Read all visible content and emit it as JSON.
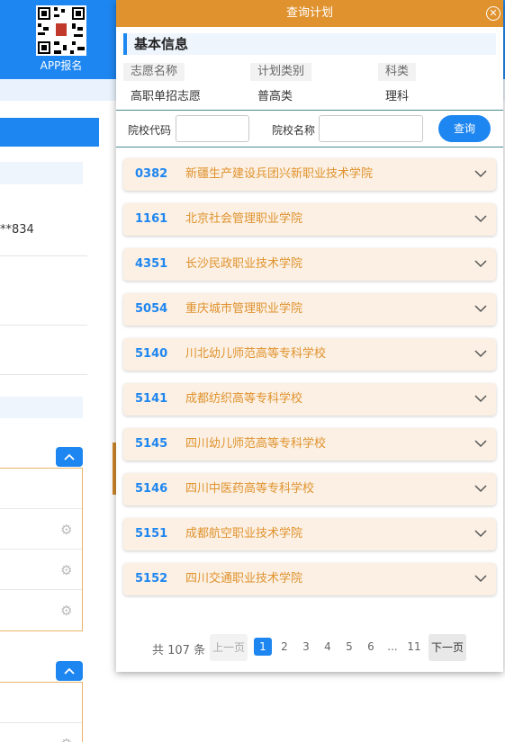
{
  "app_badge": {
    "label": "APP报名"
  },
  "background": {
    "masked_text": "**834"
  },
  "modal": {
    "title": "查询计划",
    "section_title": "基本信息",
    "info": [
      {
        "label": "志愿名称",
        "value": "高职单招志愿"
      },
      {
        "label": "计划类别",
        "value": "普高类"
      },
      {
        "label": "科类",
        "value": "理科"
      }
    ],
    "search": {
      "code_label": "院校代码",
      "code_value": "",
      "name_label": "院校名称",
      "name_value": "",
      "button_label": "查询"
    },
    "schools": [
      {
        "code": "0382",
        "name": "新疆生产建设兵团兴新职业技术学院"
      },
      {
        "code": "1161",
        "name": "北京社会管理职业学院"
      },
      {
        "code": "4351",
        "name": "长沙民政职业技术学院"
      },
      {
        "code": "5054",
        "name": "重庆城市管理职业学院"
      },
      {
        "code": "5140",
        "name": "川北幼儿师范高等专科学校"
      },
      {
        "code": "5141",
        "name": "成都纺织高等专科学校"
      },
      {
        "code": "5145",
        "name": "四川幼儿师范高等专科学校"
      },
      {
        "code": "5146",
        "name": "四川中医药高等专科学校"
      },
      {
        "code": "5151",
        "name": "成都航空职业技术学院"
      },
      {
        "code": "5152",
        "name": "四川交通职业技术学院"
      }
    ],
    "pagination": {
      "total": "共 107 条",
      "prev": "上一页",
      "pages": [
        "1",
        "2",
        "3",
        "4",
        "5",
        "6",
        "...",
        "11"
      ],
      "current": "1",
      "next": "下一页"
    }
  },
  "colors": {
    "primary_blue": "#1e86f0",
    "accent_orange": "#e0922e",
    "item_bg": "#fbf0e3"
  }
}
